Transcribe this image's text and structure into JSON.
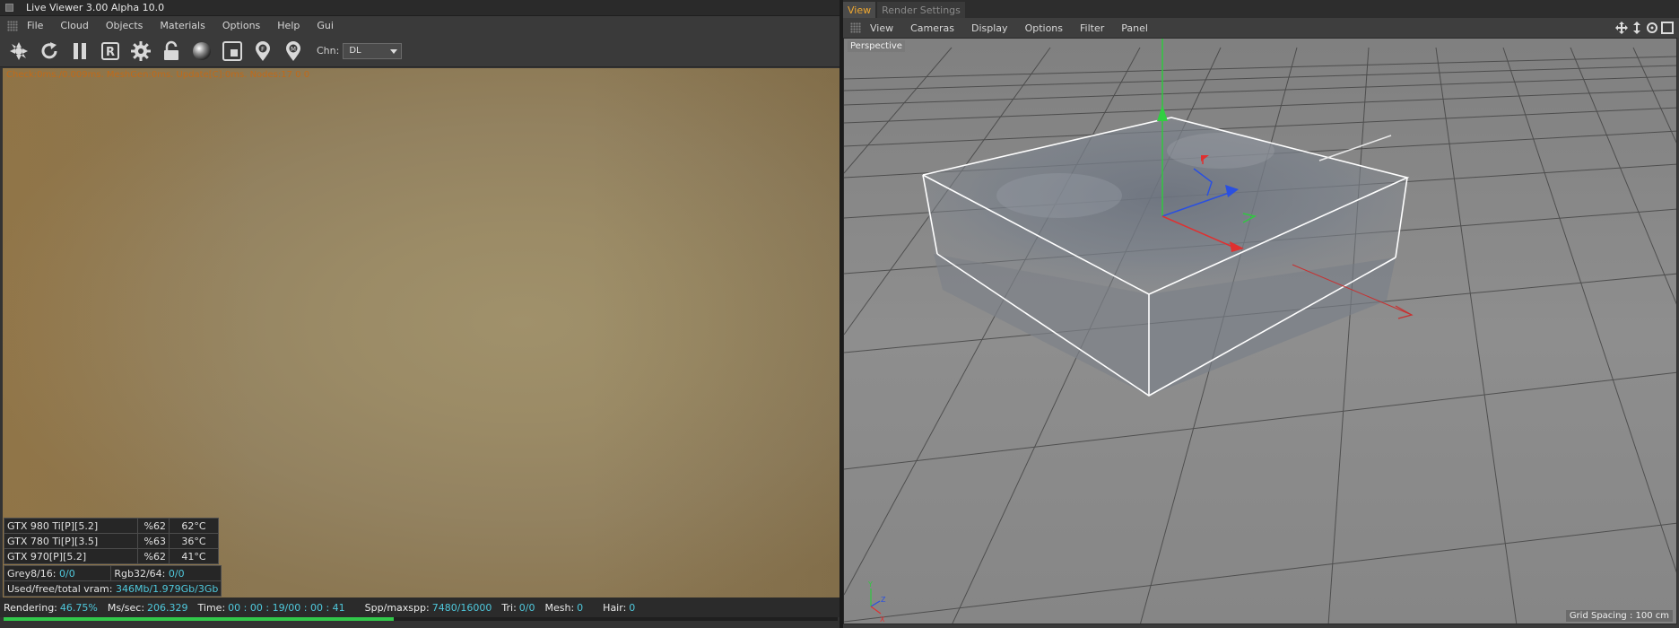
{
  "live_viewer": {
    "title": "Live Viewer 3.00 Alpha 10.0",
    "menu": [
      "File",
      "Cloud",
      "Objects",
      "Materials",
      "Options",
      "Help",
      "Gui"
    ],
    "toolbar_icons": [
      "send-scene-icon",
      "refresh-icon",
      "pause-icon",
      "region-render-icon",
      "settings-gear-icon",
      "lock-icon",
      "material-ball-icon",
      "clay-mode-icon",
      "pick-focus-icon",
      "pick-material-icon"
    ],
    "toolbar_icon_letters": {
      "pick_focus": "F",
      "pick_material": "M",
      "region": "R"
    },
    "channel": {
      "label": "Chn:",
      "value": "DL"
    },
    "status_top": "Check:0ms./0.009ms. MeshGen:0ms. Update[C]:0ms. Nodes:17 0 0",
    "gpus": [
      {
        "name": "GTX 980 Ti[P][5.2]",
        "usage": "%62",
        "temp": "62°C"
      },
      {
        "name": "GTX 780 Ti[P][3.5]",
        "usage": "%63",
        "temp": "36°C"
      },
      {
        "name": "GTX 970[P][5.2]",
        "usage": "%62",
        "temp": "41°C"
      }
    ],
    "memory": {
      "grey_label": "Grey8/16:",
      "grey_value": "0/0",
      "rgb_label": "Rgb32/64:",
      "rgb_value": "0/0",
      "vram_label": "Used/free/total vram:",
      "vram_value": "346Mb/1.979Gb/3Gb"
    },
    "status": {
      "rendering_label": "Rendering:",
      "rendering_value": "46.75%",
      "ms_label": "Ms/sec:",
      "ms_value": "206.329",
      "time_label": "Time:",
      "time_value": "00 : 00 : 19/00 : 00 : 41",
      "spp_label": "Spp/maxspp:",
      "spp_value": "7480/16000",
      "tri_label": "Tri:",
      "tri_value": "0/0",
      "mesh_label": "Mesh:",
      "mesh_value": "0",
      "hair_label": "Hair:",
      "hair_value": "0"
    },
    "progress": 0.4675
  },
  "c4d": {
    "tabs": [
      "View",
      "Render Settings"
    ],
    "menu": [
      "View",
      "Cameras",
      "Display",
      "Options",
      "Filter",
      "Panel"
    ],
    "viewport_label": "Perspective",
    "grid_spacing": "Grid Spacing : 100 cm",
    "axis_labels": {
      "y": "Y",
      "z": "Z",
      "x": "X"
    }
  },
  "colors": {
    "accent_orange": "#f0a830",
    "value_cyan": "#4fc8dc",
    "progress_green": "#31c84a",
    "status_orange": "#c06a1a",
    "axis_x": "#e03030",
    "axis_y": "#30d040",
    "axis_z": "#2a50e0"
  }
}
